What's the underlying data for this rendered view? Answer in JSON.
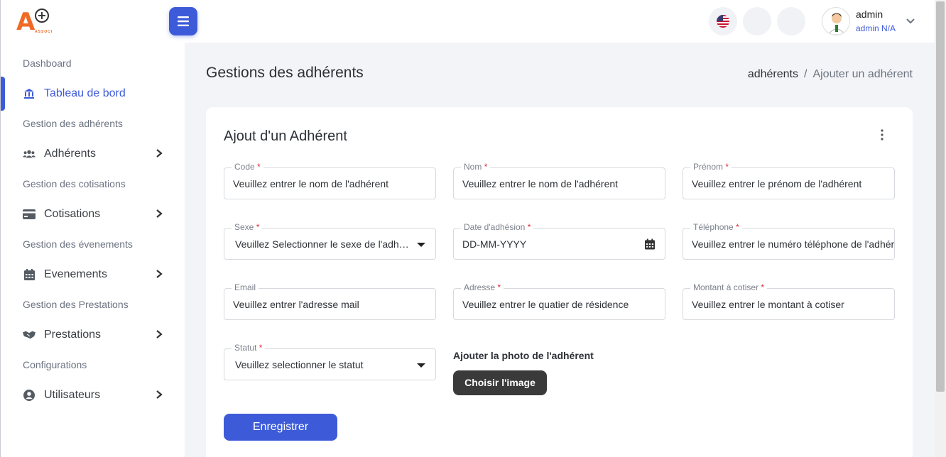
{
  "app": {
    "logo_text": "A",
    "logo_subtext": "ASSOCI"
  },
  "sidebar": {
    "sections": [
      {
        "title": "Dashboard"
      },
      {
        "title": "Gestion des adhérents"
      },
      {
        "title": "Gestion des cotisations"
      },
      {
        "title": "Gestion des évenements"
      },
      {
        "title": "Gestion des Prestations"
      },
      {
        "title": "Configurations"
      }
    ],
    "items": [
      {
        "label": "Tableau de bord",
        "icon": "bank-icon",
        "active": true
      },
      {
        "label": "Adhérents",
        "icon": "users-icon"
      },
      {
        "label": "Cotisations",
        "icon": "credit-card-icon"
      },
      {
        "label": "Evenements",
        "icon": "calendar-icon"
      },
      {
        "label": "Prestations",
        "icon": "handshake-icon"
      },
      {
        "label": "Utilisateurs",
        "icon": "user-circle-icon"
      }
    ]
  },
  "header": {
    "user_name": "admin",
    "user_role": "admin N/A"
  },
  "page": {
    "title": "Gestions des adhérents",
    "breadcrumb": [
      "adhérents",
      "/",
      "Ajouter un adhérent"
    ]
  },
  "form": {
    "title": "Ajout d'un Adhérent",
    "fields": {
      "code": {
        "label": "Code",
        "value": "Veuillez entrer le nom de l'adhérent"
      },
      "nom": {
        "label": "Nom",
        "value": "Veuillez entrer le nom de l'adhérent"
      },
      "prenom": {
        "label": "Prénom",
        "value": "Veuillez entrer le prénom de l'adhérent"
      },
      "sexe": {
        "label": "Sexe",
        "value": "Veuillez Selectionner le sexe de l'adhérent"
      },
      "date": {
        "label": "Date d'adhésion",
        "value": "DD-MM-YYYY"
      },
      "telephone": {
        "label": "Téléphone",
        "value": "Veuillez entrer le numéro téléphone de l'adhérent"
      },
      "email": {
        "label": "Email",
        "value": "Veuillez entrer l'adresse mail"
      },
      "adresse": {
        "label": "Adresse",
        "value": "Veuillez entrer le quatier de résidence"
      },
      "montant": {
        "label": "Montant à cotiser",
        "value": "Veuillez entrer le montant à cotiser"
      },
      "statut": {
        "label": "Statut",
        "value": "Veuillez selectionner le statut"
      }
    },
    "required_mark": "*",
    "photo_label": "Ajouter la photo de l'adhérent",
    "choose_image": "Choisir l'image",
    "save": "Enregistrer"
  },
  "colors": {
    "accent": "#3d5bd9",
    "logo_orange": "#f06a25",
    "required": "#e0263a"
  }
}
